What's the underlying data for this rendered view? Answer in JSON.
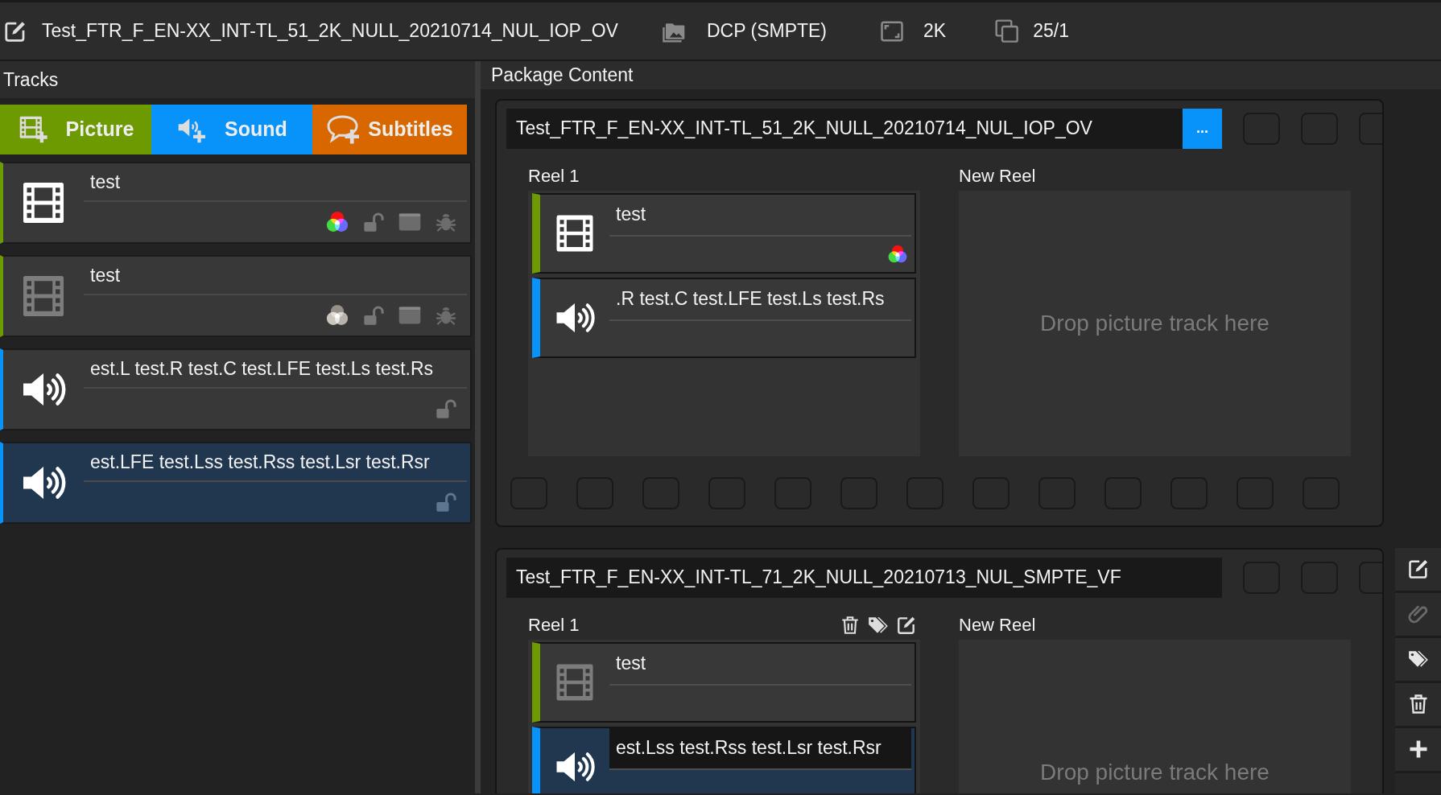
{
  "header": {
    "title": "Test_FTR_F_EN-XX_INT-TL_51_2K_NULL_20210714_NUL_IOP_OV",
    "standard": "DCP (SMPTE)",
    "resolution": "2K",
    "frame_rate": "25/1"
  },
  "tracks_panel": {
    "title": "Tracks",
    "add_buttons": [
      {
        "kind": "picture",
        "label": "Picture"
      },
      {
        "kind": "sound",
        "label": "Sound"
      },
      {
        "kind": "subtitles",
        "label": "Subtitles"
      }
    ],
    "tracks": [
      {
        "kind": "picture",
        "name": "test",
        "enabled": true,
        "selected": false
      },
      {
        "kind": "picture",
        "name": "test",
        "enabled": false,
        "selected": false
      },
      {
        "kind": "sound",
        "name": "est.L test.R test.C test.LFE test.Ls test.Rs",
        "enabled": true,
        "selected": false
      },
      {
        "kind": "sound",
        "name": "est.LFE test.Lss test.Rss test.Lsr test.Rsr",
        "enabled": true,
        "selected": true
      }
    ]
  },
  "package_panel": {
    "title": "Package Content",
    "packages": [
      {
        "title": "Test_FTR_F_EN-XX_INT-TL_51_2K_NULL_20210714_NUL_IOP_OV",
        "menu_button": "...",
        "reels": [
          {
            "label": "Reel 1",
            "show_tools": false,
            "items": [
              {
                "kind": "picture",
                "name": "test",
                "enabled": true,
                "selected": false
              },
              {
                "kind": "sound",
                "name": ".R test.C test.LFE test.Ls test.Rs",
                "enabled": true,
                "selected": false
              }
            ]
          }
        ],
        "new_reel": {
          "label": "New Reel",
          "placeholder": "Drop picture track here"
        }
      },
      {
        "title": "Test_FTR_F_EN-XX_INT-TL_71_2K_NULL_20210713_NUL_SMPTE_VF",
        "reels": [
          {
            "label": "Reel 1",
            "show_tools": true,
            "items": [
              {
                "kind": "picture",
                "name": "test",
                "enabled": false,
                "selected": false
              },
              {
                "kind": "sound",
                "name": "est.Lss test.Rss test.Lsr test.Rsr",
                "enabled": true,
                "selected": true
              }
            ]
          }
        ],
        "new_reel": {
          "label": "New Reel",
          "placeholder": "Drop picture track here"
        }
      }
    ]
  },
  "side_toolbar": [
    {
      "kind": "edit",
      "disabled": false
    },
    {
      "kind": "attach",
      "disabled": true
    },
    {
      "kind": "tag",
      "disabled": false
    },
    {
      "kind": "delete",
      "disabled": false
    },
    {
      "kind": "add",
      "disabled": false
    }
  ]
}
